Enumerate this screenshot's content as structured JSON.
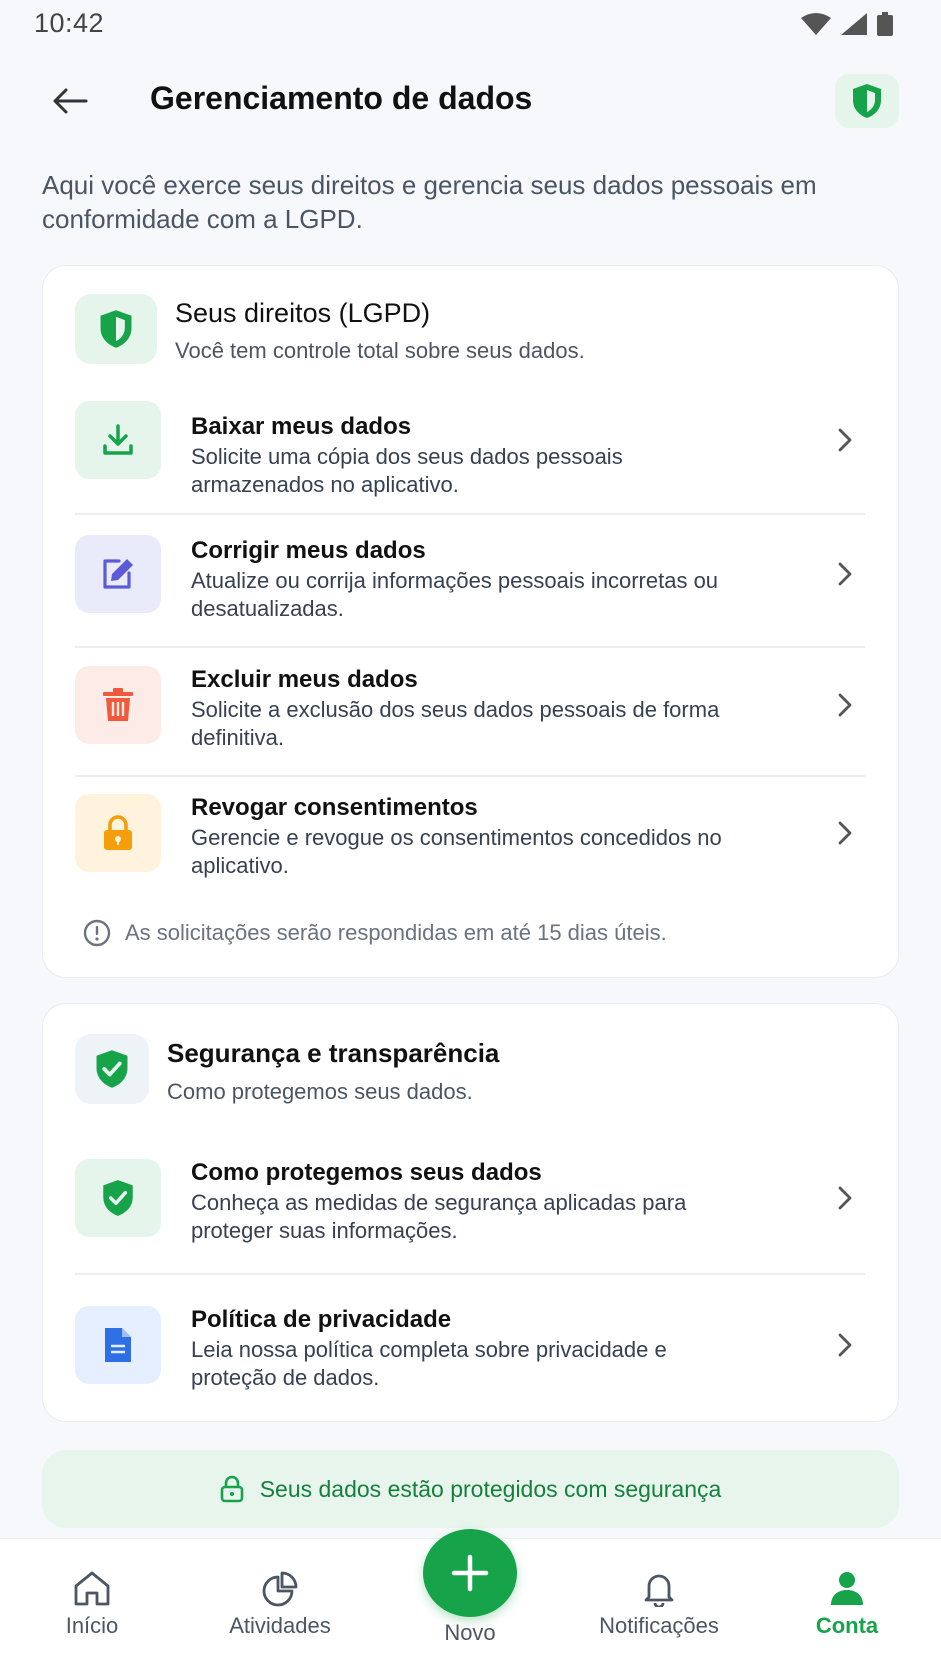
{
  "status_bar": {
    "time": "10:42"
  },
  "header": {
    "title": "Gerenciamento de dados"
  },
  "intro": "Aqui você exerce seus direitos e gerencia seus dados pessoais em conformidade com a LGPD.",
  "rights_card": {
    "title": "Seus direitos (LGPD)",
    "subtitle": "Você tem controle total sobre seus dados.",
    "items": [
      {
        "title": "Baixar meus dados",
        "description": "Solicite uma cópia dos seus dados pessoais armazenados no aplicativo.",
        "icon": "download-icon"
      },
      {
        "title": "Corrigir meus dados",
        "description": "Atualize ou corrija informações pessoais incorretas ou desatualizadas.",
        "icon": "edit-icon"
      },
      {
        "title": "Excluir meus dados",
        "description": "Solicite a exclusão dos seus dados pessoais de forma definitiva.",
        "icon": "trash-icon"
      },
      {
        "title": "Revogar consentimentos",
        "description": "Gerencie e revogue os consentimentos concedidos no aplicativo.",
        "icon": "lock-icon"
      }
    ],
    "note": "As solicitações serão respondidas em até 15 dias úteis."
  },
  "security_card": {
    "title": "Segurança e transparência",
    "subtitle": "Como protegemos seus dados.",
    "items": [
      {
        "title": "Como protegemos seus dados",
        "description": "Conheça as medidas de segurança aplicadas para proteger suas informações.",
        "icon": "shield-check-icon"
      },
      {
        "title": "Política de privacidade",
        "description": "Leia nossa política completa sobre privacidade e proteção de dados.",
        "icon": "document-icon"
      }
    ]
  },
  "banner": "Seus dados estão protegidos com segurança",
  "bottom_nav": {
    "items": [
      {
        "label": "Início",
        "icon": "home-icon"
      },
      {
        "label": "Atividades",
        "icon": "pie-chart-icon"
      },
      {
        "label": "Novo",
        "icon": "plus-icon"
      },
      {
        "label": "Notificações",
        "icon": "bell-icon"
      },
      {
        "label": "Conta",
        "icon": "user-icon"
      }
    ],
    "active": "Conta"
  },
  "colors": {
    "accent": "#16a34a",
    "text": "#111827",
    "muted": "#4b5563"
  }
}
